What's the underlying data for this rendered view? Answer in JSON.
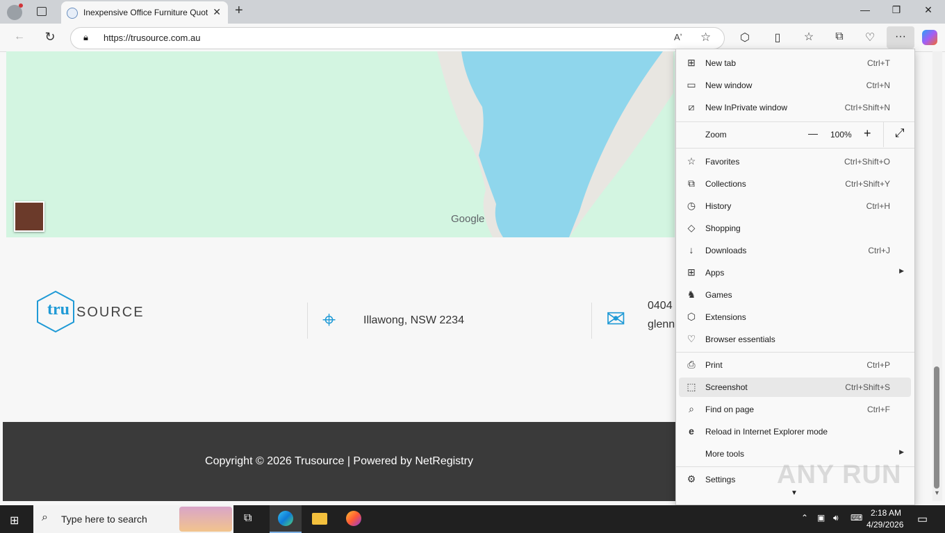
{
  "browser": {
    "tab_title": "Inexpensive Office Furniture Quot",
    "tab_close": "✕",
    "new_tab": "+",
    "url": "https://trusource.com.au",
    "window_controls": {
      "minimize": "—",
      "maximize": "❐",
      "close": "✕"
    }
  },
  "toolbar_icons": [
    "back-icon",
    "refresh-icon",
    "read-aloud-icon",
    "favorite-star-icon",
    "extensions-icon",
    "split-screen-icon",
    "favorites-icon",
    "collections-icon",
    "browser-essentials-icon",
    "more-icon",
    "copilot-icon"
  ],
  "map": {
    "brand": "Google"
  },
  "footer": {
    "logo_tru": "tru",
    "logo_source": "SOURCE",
    "location": "Illawong, NSW 2234",
    "phone_partial": "0404",
    "email_partial": "glenn",
    "copyright": "Copyright © 2026 Trusource | Powered by NetRegistry"
  },
  "menu": {
    "new_tab": {
      "label": "New tab",
      "shortcut": "Ctrl+T"
    },
    "new_window": {
      "label": "New window",
      "shortcut": "Ctrl+N"
    },
    "new_inprivate": {
      "label": "New InPrivate window",
      "shortcut": "Ctrl+Shift+N"
    },
    "zoom": {
      "label": "Zoom",
      "value": "100%",
      "minus": "—",
      "plus": "+",
      "fullscreen": "⤢"
    },
    "favorites": {
      "label": "Favorites",
      "shortcut": "Ctrl+Shift+O"
    },
    "collections": {
      "label": "Collections",
      "shortcut": "Ctrl+Shift+Y"
    },
    "history": {
      "label": "History",
      "shortcut": "Ctrl+H"
    },
    "shopping": {
      "label": "Shopping"
    },
    "downloads": {
      "label": "Downloads",
      "shortcut": "Ctrl+J"
    },
    "apps": {
      "label": "Apps"
    },
    "games": {
      "label": "Games"
    },
    "extensions": {
      "label": "Extensions"
    },
    "browser_essentials": {
      "label": "Browser essentials"
    },
    "print": {
      "label": "Print",
      "shortcut": "Ctrl+P"
    },
    "screenshot": {
      "label": "Screenshot",
      "shortcut": "Ctrl+Shift+S"
    },
    "find": {
      "label": "Find on page",
      "shortcut": "Ctrl+F"
    },
    "ie_mode": {
      "label": "Reload in Internet Explorer mode"
    },
    "more_tools": {
      "label": "More tools"
    },
    "settings": {
      "label": "Settings"
    }
  },
  "taskbar": {
    "search_placeholder": "Type here to search",
    "time": "2:18 AM",
    "date": "4/29/2026"
  },
  "watermark": "ANY RUN"
}
